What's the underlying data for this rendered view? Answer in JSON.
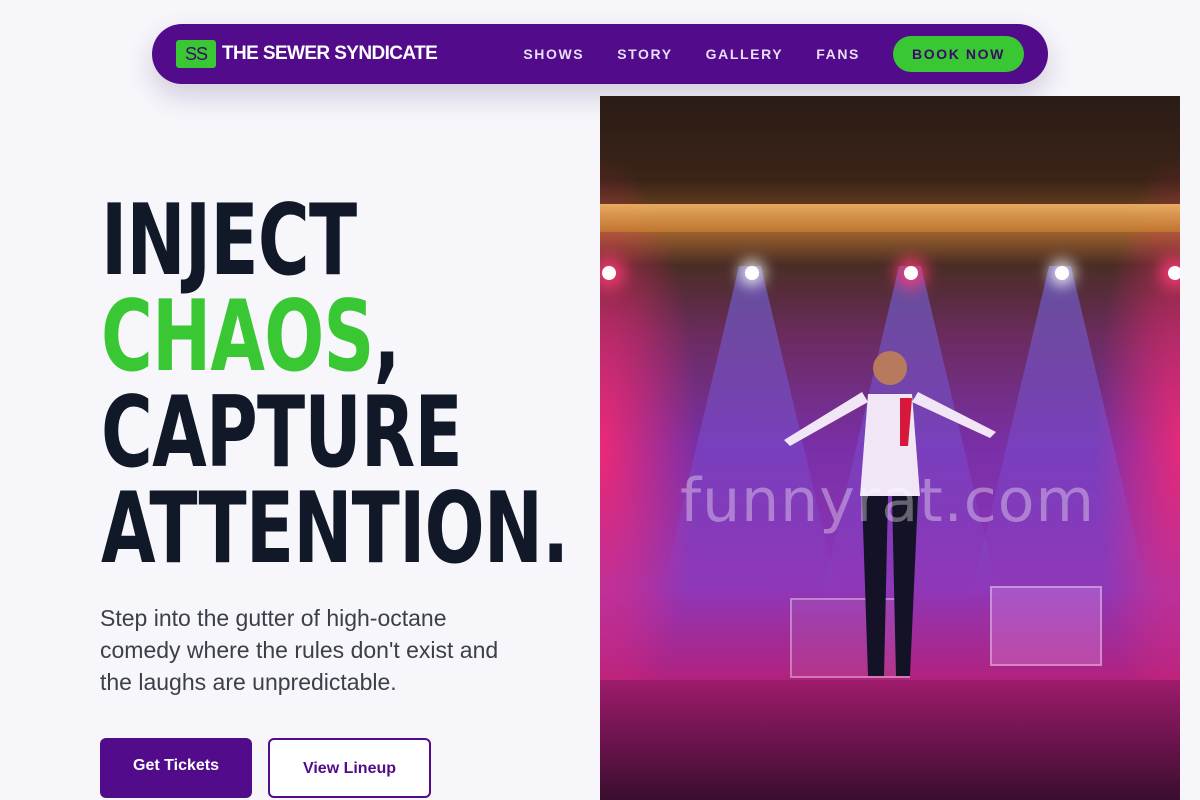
{
  "nav": {
    "logo_mark": "SS",
    "brand_name": "THE SEWER SYNDICATE",
    "links": [
      "SHOWS",
      "STORY",
      "GALLERY",
      "FANS"
    ],
    "cta_label": "BOOK NOW"
  },
  "hero": {
    "headline": {
      "line1": "INJECT",
      "line2_accent": "CHAOS",
      "line2_rest": ",",
      "line3": "CAPTURE",
      "line4": "ATTENTION."
    },
    "lede": "Step into the gutter of high-octane comedy where the rules don't exist and the laughs are unpredictable.",
    "primary_button": "Get Tickets",
    "secondary_button": "View Lineup"
  },
  "image": {
    "watermark": "funnyrat.com"
  },
  "colors": {
    "brand_purple": "#520b8b",
    "accent_green": "#39c733",
    "ink": "#111827",
    "background": "#f6f6fb"
  }
}
